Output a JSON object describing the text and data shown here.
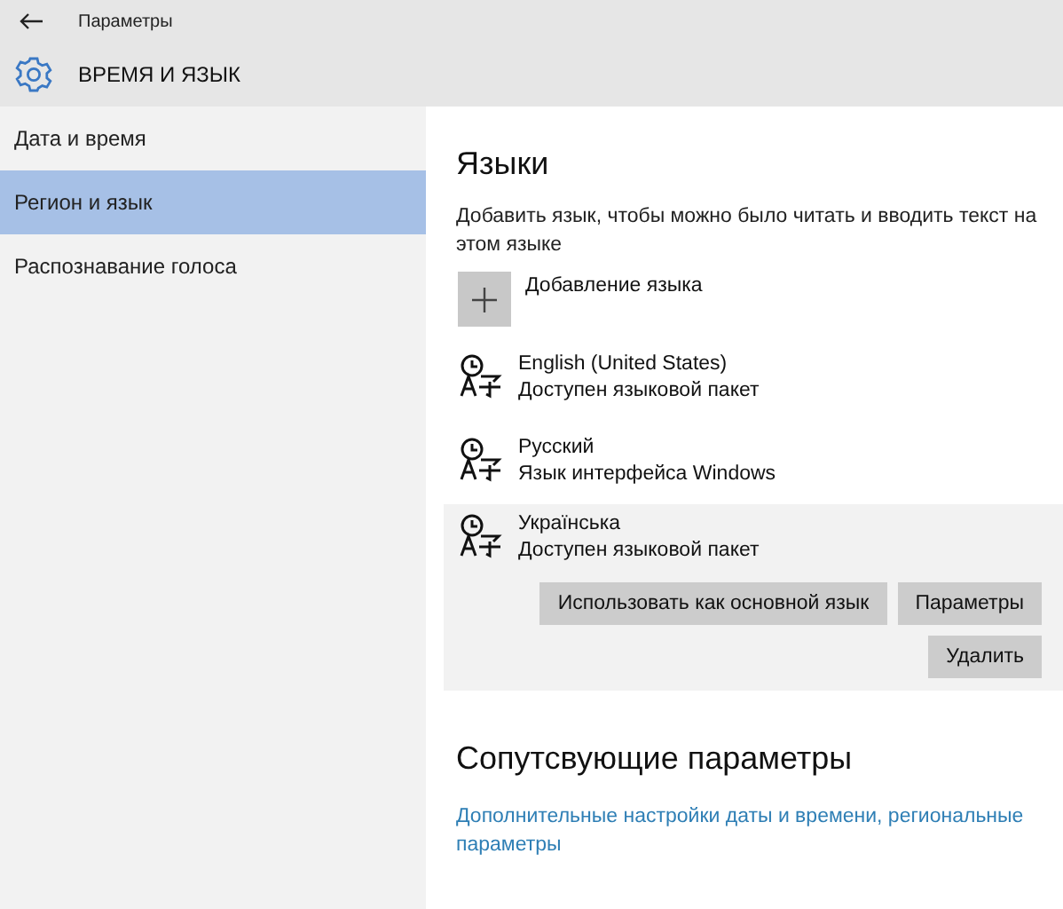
{
  "window": {
    "title": "Параметры"
  },
  "section": {
    "title": "ВРЕМЯ И ЯЗЫК"
  },
  "sidebar": {
    "items": [
      {
        "label": "Дата и время",
        "selected": false
      },
      {
        "label": "Регион и язык",
        "selected": true
      },
      {
        "label": "Распознавание голоса",
        "selected": false
      }
    ]
  },
  "languages_section": {
    "title": "Языки",
    "description": "Добавить язык, чтобы можно было читать и вводить текст на этом языке",
    "add_label": "Добавление языка",
    "languages": [
      {
        "name": "English (United States)",
        "status": "Доступен языковой пакет",
        "selected": false
      },
      {
        "name": "Русский",
        "status": "Язык интерфейса Windows",
        "selected": false
      },
      {
        "name": "Українська",
        "status": "Доступен языковой пакет",
        "selected": true
      }
    ],
    "actions": [
      "Использовать как основной язык",
      "Параметры",
      "Удалить"
    ]
  },
  "related": {
    "title": "Сопутсвующие параметры",
    "link": "Дополнительные настройки даты и времени, региональные параметры"
  }
}
